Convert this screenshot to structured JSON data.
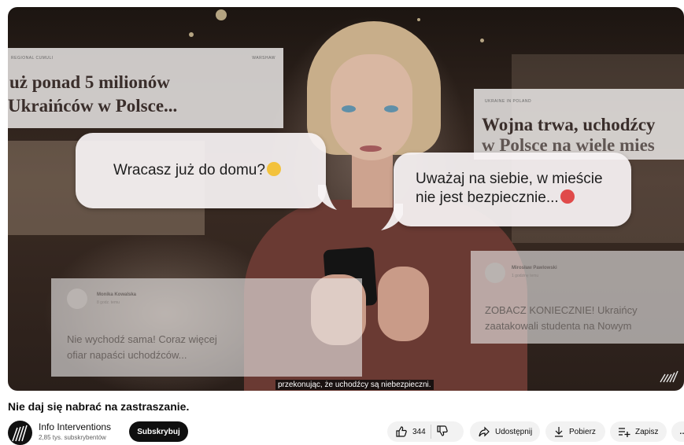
{
  "video": {
    "caption": "przekonując, że uchodźcy są niebezpieczni.",
    "news_left": {
      "kicker_left": "REGIONAL CUMULI",
      "kicker_right": "WARSHAW",
      "line1": "uż ponad 5 milionów",
      "line2": "Ukraińców w Polsce..."
    },
    "news_right": {
      "kicker": "UKRAINE IN POLAND",
      "line1": "Wojna trwa, uchodźcy",
      "line2": "w Polsce na wiele mies"
    },
    "bubble_left": {
      "text": "Wracasz już do domu?",
      "emoji": "scared-face-emoji"
    },
    "bubble_right": {
      "line1": "Uważaj na siebie, w mieście",
      "line2": "nie jest bezpiecznie...",
      "emoji": "angry-face-emoji"
    },
    "social_left": {
      "name": "Monika Kowalska",
      "time": "8 godz. temu",
      "line1": "Nie wychodź sama! Coraz więcej",
      "line2": "ofiar napaści uchodźców..."
    },
    "social_right": {
      "name": "Mirosław Pawlowski",
      "time": "1 godzinę temu",
      "line1": "ZOBACZ KONIECZNIE! Ukraińcy",
      "line2": "zaatakowali studenta na Nowym"
    }
  },
  "title": "Nie daj się nabrać na zastraszanie.",
  "channel": {
    "name": "Info Interventions",
    "subscribers": "2,85 tys. subskrybentów",
    "subscribe_label": "Subskrybuj"
  },
  "actions": {
    "like_count": "344",
    "share_label": "Udostępnij",
    "download_label": "Pobierz",
    "save_label": "Zapisz",
    "more_label": "…"
  },
  "colors": {
    "subscribe_bg": "#0f0f0f",
    "pill_bg": "#f2f2f2",
    "text": "#0f0f0f"
  }
}
